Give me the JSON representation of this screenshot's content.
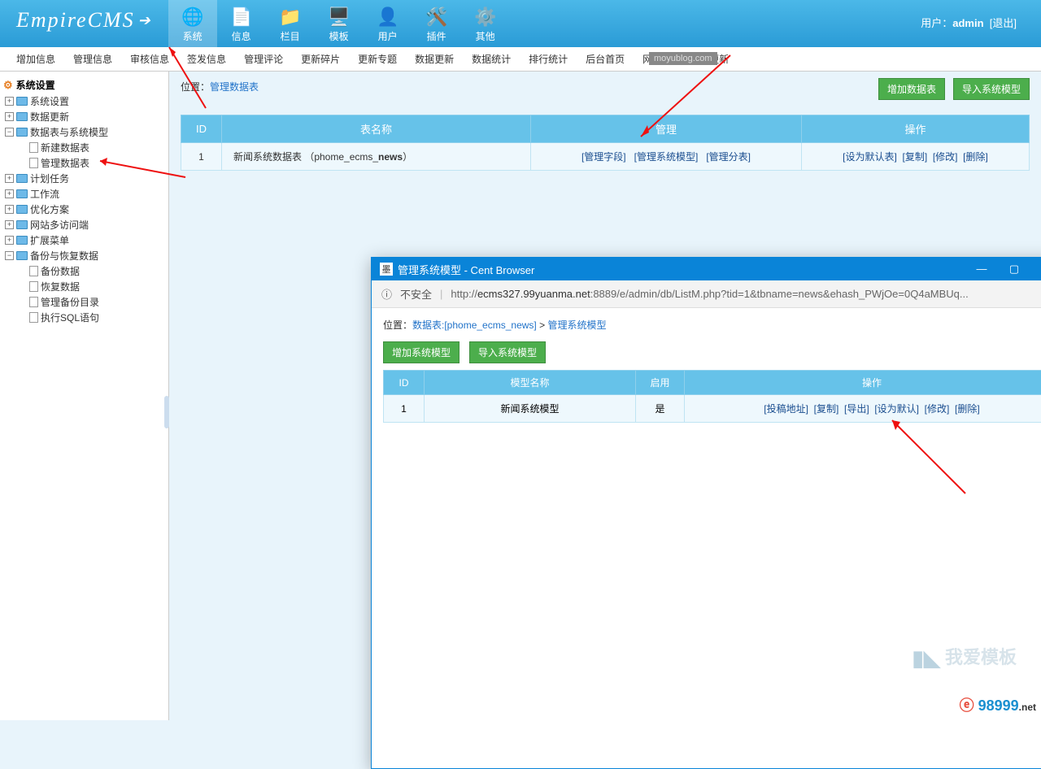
{
  "logo": "EmpireCMS",
  "user": {
    "label": "用户：",
    "name": "admin",
    "logout": "[退出]"
  },
  "topnav": [
    {
      "label": "系统",
      "active": true
    },
    {
      "label": "信息"
    },
    {
      "label": "栏目"
    },
    {
      "label": "模板"
    },
    {
      "label": "用户"
    },
    {
      "label": "插件"
    },
    {
      "label": "其他"
    }
  ],
  "subnav": [
    "增加信息",
    "管理信息",
    "审核信息",
    "签发信息",
    "管理评论",
    "更新碎片",
    "更新专题",
    "数据更新",
    "数据统计",
    "排行统计",
    "后台首页",
    "网站首页",
    "本更新"
  ],
  "watermark_bar": "moyublog.com",
  "sidebar": {
    "root": "系统设置",
    "items": [
      {
        "pm": "+",
        "label": "系统设置",
        "lv": 1
      },
      {
        "pm": "+",
        "label": "数据更新",
        "lv": 1
      },
      {
        "pm": "−",
        "label": "数据表与系统模型",
        "lv": 1
      },
      {
        "pm": "",
        "label": "新建数据表",
        "lv": 2,
        "leaf": true
      },
      {
        "pm": "",
        "label": "管理数据表",
        "lv": 2,
        "leaf": true
      },
      {
        "pm": "+",
        "label": "计划任务",
        "lv": 1
      },
      {
        "pm": "+",
        "label": "工作流",
        "lv": 1
      },
      {
        "pm": "+",
        "label": "优化方案",
        "lv": 1
      },
      {
        "pm": "+",
        "label": "网站多访问端",
        "lv": 1
      },
      {
        "pm": "+",
        "label": "扩展菜单",
        "lv": 1
      },
      {
        "pm": "−",
        "label": "备份与恢复数据",
        "lv": 1
      },
      {
        "pm": "",
        "label": "备份数据",
        "lv": 3,
        "leaf": true
      },
      {
        "pm": "",
        "label": "恢复数据",
        "lv": 3,
        "leaf": true
      },
      {
        "pm": "",
        "label": "管理备份目录",
        "lv": 3,
        "leaf": true
      },
      {
        "pm": "",
        "label": "执行SQL语句",
        "lv": 3,
        "leaf": true
      }
    ]
  },
  "main": {
    "crumb_prefix": "位置：",
    "crumb_link": "管理数据表",
    "btn_add": "增加数据表",
    "btn_import": "导入系统模型",
    "headers": [
      "ID",
      "表名称",
      "管理",
      "操作"
    ],
    "row": {
      "id": "1",
      "name_pre": "新闻系统数据表 （phome_ecms_",
      "name_bold": "news",
      "name_suf": "）",
      "m1": "[管理字段]",
      "m2": "[管理系统模型]",
      "m3": "[管理分表]",
      "o1": "[设为默认表]",
      "o2": "[复制]",
      "o3": "[修改]",
      "o4": "[删除]"
    }
  },
  "popup": {
    "title_prefix": "墨",
    "title": "管理系统模型 - Cent Browser",
    "win": {
      "min": "—",
      "max": "▢",
      "close": "✕"
    },
    "insecure_icon": "ⓘ",
    "insecure": "不安全",
    "url_bold": "ecms327.99yuanma.net",
    "url_rest": ":8889/e/admin/db/ListM.php?tid=1&tbname=news&ehash_PWjOe=0Q4aMBUq...",
    "url_prefix": "http://",
    "crumb_prefix": "位置：",
    "crumb_tbl": "数据表:[phome_ecms_news]",
    "crumb_cur": "管理系统模型",
    "btn_add": "增加系统模型",
    "btn_import": "导入系统模型",
    "headers": [
      "ID",
      "模型名称",
      "启用",
      "操作"
    ],
    "row": {
      "id": "1",
      "name": "新闻系统模型",
      "enabled": "是",
      "a1": "[投稿地址]",
      "a2": "[复制]",
      "a3": "[导出]",
      "a4": "[设为默认]",
      "a5": "[修改]",
      "a6": "[删除]"
    }
  },
  "footer": {
    "wm1": "我爱模板",
    "wm2a": "98999",
    "wm2b": ".net"
  }
}
